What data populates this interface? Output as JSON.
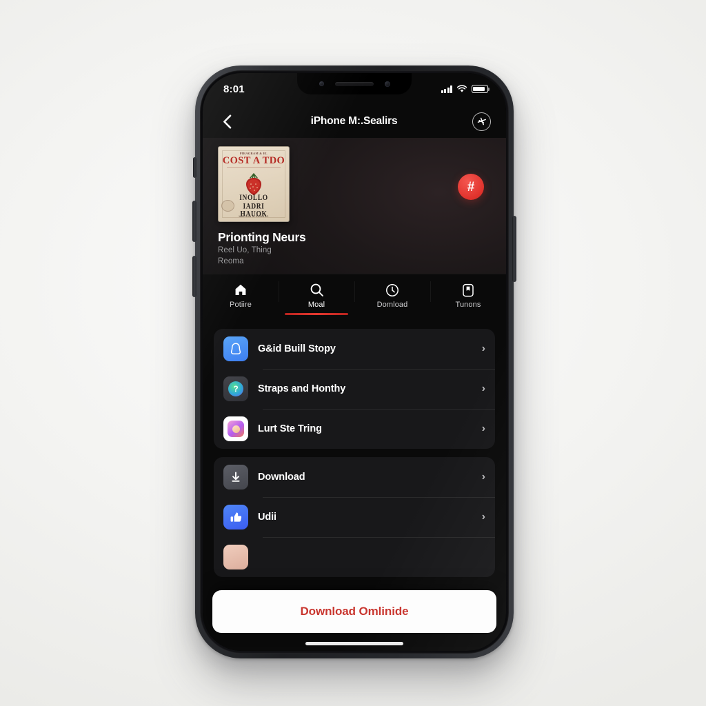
{
  "status_bar": {
    "time": "8:01",
    "signal_icon": "cellular-signal-icon",
    "wifi_icon": "wifi-icon",
    "battery_icon": "battery-icon"
  },
  "nav": {
    "back_icon": "chevron-left-icon",
    "title": "iPhone M:.Sealirs",
    "action_icon": "airplane-plus-icon"
  },
  "hero": {
    "album": {
      "pretitle": "PIRAGRAM & EL",
      "title": "COST A TDO",
      "sub_line1": "INOLLO",
      "sub_line2": "IADRI",
      "sub_line3": "HAUOK",
      "footer": "WRITTEN ALRUALYRO"
    },
    "badge_label": "#",
    "title": "Prionting Neurs",
    "subtitle_line1": "Reel Uo, Thing",
    "subtitle_line2": "Reoma"
  },
  "tabs": [
    {
      "label": "Potiire",
      "icon": "home-icon",
      "active": false
    },
    {
      "label": "Moal",
      "icon": "search-icon",
      "active": true
    },
    {
      "label": "Domload",
      "icon": "clock-icon",
      "active": false
    },
    {
      "label": "Tunons",
      "icon": "bookmark-icon",
      "active": false
    }
  ],
  "groups": [
    {
      "rows": [
        {
          "label": "G&id Buill Stopy",
          "icon": "bell-app-icon",
          "chevron": "›"
        },
        {
          "label": "Straps and Honthy",
          "icon": "compass-app-icon",
          "chevron": "›"
        },
        {
          "label": "Lurt Ste Tring",
          "icon": "photos-app-icon",
          "chevron": "›"
        }
      ]
    },
    {
      "rows": [
        {
          "label": "Download",
          "icon": "download-arrow-icon",
          "chevron": "›"
        },
        {
          "label": "Udii",
          "icon": "thumbs-up-icon",
          "chevron": "›"
        },
        {
          "label": "",
          "icon": "partial-app-icon",
          "chevron": ""
        }
      ]
    }
  ],
  "cta": {
    "label": "Download Omlinide"
  },
  "colors": {
    "accent_red": "#e0322c",
    "cta_text": "#c9362f",
    "screen_bg": "#0a0a0a",
    "card_bg": "#18181a"
  }
}
